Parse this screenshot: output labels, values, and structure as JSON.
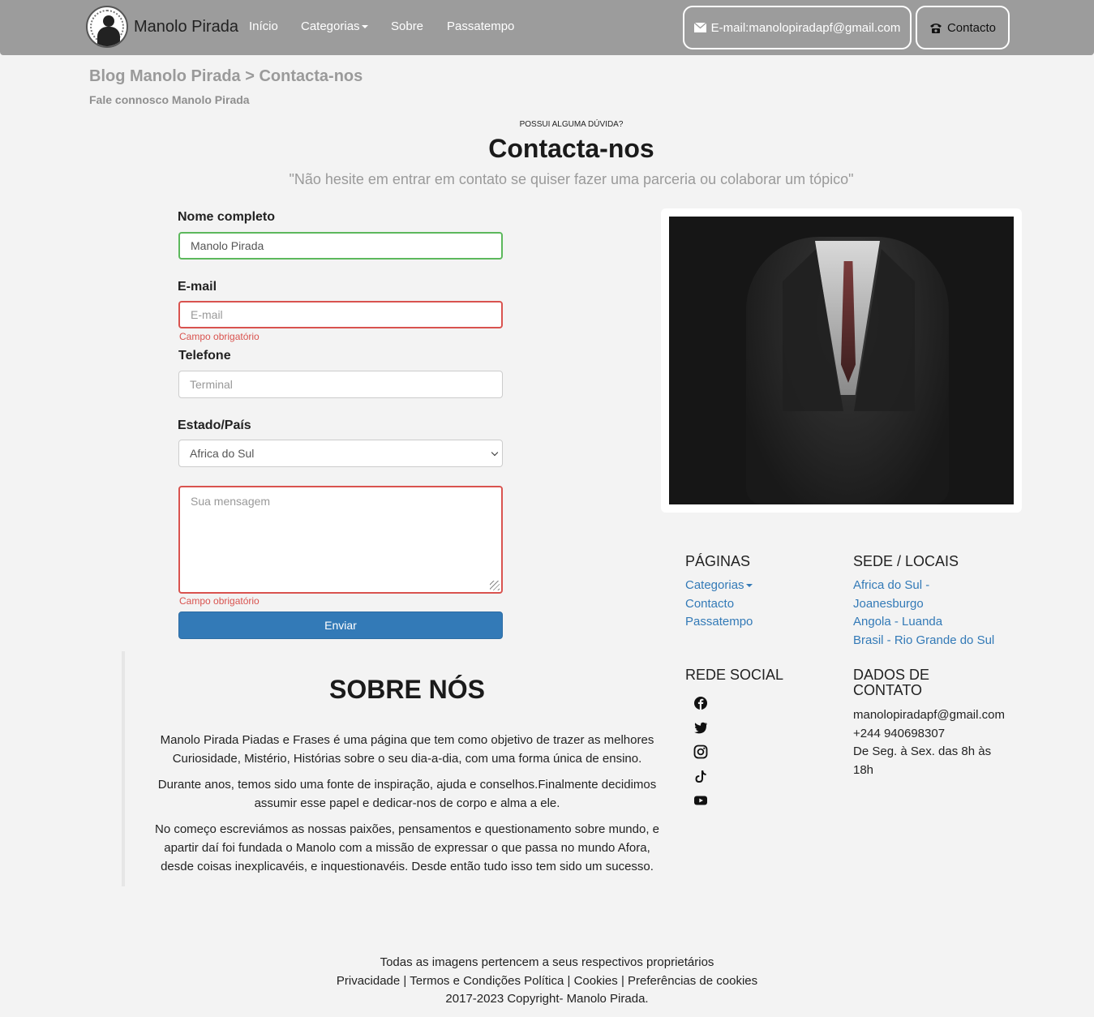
{
  "navbar": {
    "brand": "Manolo Pirada",
    "links": [
      "Início",
      "Categorias",
      "Sobre",
      "Passatempo"
    ],
    "email_button": "E-mail:manolopiradapf@gmail.com",
    "contact_button": "Contacto"
  },
  "breadcrumb": {
    "text": "Blog Manolo Pirada > Contacta-nos",
    "subtitle": "Fale connosco Manolo Pirada"
  },
  "hero": {
    "kicker": "POSSUI ALGUMA DÚVIDA?",
    "title": "Contacta-nos",
    "quote": "\"Não hesite em entrar em contato se quiser fazer uma parceria ou colaborar um tópico\""
  },
  "form": {
    "name_label": "Nome completo",
    "name_value": "Manolo Pirada",
    "email_label": "E-mail",
    "email_placeholder": "E-mail",
    "email_error": "Campo obrigatório",
    "phone_label": "Telefone",
    "phone_placeholder": "Terminal",
    "country_label": "Estado/País",
    "country_selected": "Africa do Sul",
    "message_placeholder": "Sua mensagem",
    "message_error": "Campo obrigatório",
    "submit": "Enviar"
  },
  "sobre": {
    "title": "SOBRE NÓS",
    "paragraphs": [
      "Manolo Pirada Piadas e Frases é uma página que tem como objetivo de trazer as melhores Curiosidade, Mistério, Histórias sobre o seu dia-a-dia, com uma forma única de ensino.",
      "Durante anos, temos sido uma fonte de inspiração, ajuda e conselhos.Finalmente decidimos assumir esse papel e dedicar-nos de corpo e alma a ele.",
      "No começo escreviámos as nossas paixões, pensamentos e questionamento sobre mundo, e apartir daí foi fundada o Manolo com a missão de expressar o que passa no mundo Afora, desde coisas inexplicavéis, e inquestionavéis. Desde então tudo isso tem sido um sucesso."
    ]
  },
  "footer": {
    "paginas_title": "PÁGINAS",
    "paginas": [
      "Categorias",
      "Contacto",
      "Passatempo"
    ],
    "sede_title": "SEDE / LOCAIS",
    "sede": [
      "Africa do Sul -",
      "Joanesburgo",
      "Angola - Luanda",
      "Brasil - Rio Grande do Sul"
    ],
    "social_title": "REDE SOCIAL",
    "social_icons": [
      "facebook-icon",
      "twitter-icon",
      "instagram-icon",
      "tiktok-icon",
      "youtube-icon"
    ],
    "dados_title_1": "DADOS DE",
    "dados_title_2": "CONTATO",
    "dados": [
      "manolopiradapf@gmail.com",
      "+244 940698307",
      "De Seg. à Sex. das 8h às",
      "18h"
    ],
    "legal_1": "Todas as imagens pertencem a seus respectivos proprietários",
    "legal_links": [
      "Privacidade",
      "Termos e Condições Política",
      "Cookies",
      "Preferências de cookies"
    ],
    "legal_sep": "|",
    "copyright": "2017-2023 Copyright- Manolo Pirada."
  },
  "colors": {
    "navbar": "#9c9c9c",
    "primary": "#337ab7",
    "error": "#d9534f",
    "success": "#5cb85c"
  }
}
